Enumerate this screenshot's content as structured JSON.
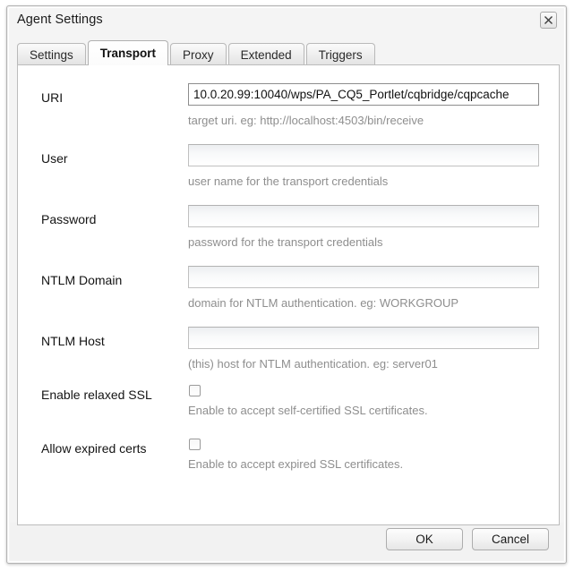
{
  "dialog": {
    "title": "Agent Settings",
    "close_icon": "close-x-icon"
  },
  "tabs": [
    {
      "label": "Settings",
      "active": false
    },
    {
      "label": "Transport",
      "active": true
    },
    {
      "label": "Proxy",
      "active": false
    },
    {
      "label": "Extended",
      "active": false
    },
    {
      "label": "Triggers",
      "active": false
    }
  ],
  "form": {
    "rows": [
      {
        "label": "URI",
        "type": "text",
        "value": "10.0.20.99:10040/wps/PA_CQ5_Portlet/cqbridge/cqpcache",
        "placeholder": "",
        "hint": "target uri. eg: http://localhost:4503/bin/receive"
      },
      {
        "label": "User",
        "type": "text",
        "value": "",
        "placeholder": "",
        "hint": "user name for the transport credentials"
      },
      {
        "label": "Password",
        "type": "password",
        "value": "",
        "placeholder": "",
        "hint": "password for the transport credentials"
      },
      {
        "label": "NTLM Domain",
        "type": "text",
        "value": "",
        "placeholder": "",
        "hint": "domain for NTLM authentication. eg: WORKGROUP"
      },
      {
        "label": "NTLM Host",
        "type": "text",
        "value": "",
        "placeholder": "",
        "hint": "(this) host for NTLM authentication. eg: server01"
      },
      {
        "label": "Enable relaxed SSL",
        "type": "checkbox",
        "checked": false,
        "hint": "Enable to accept self-certified SSL certificates."
      },
      {
        "label": "Allow expired certs",
        "type": "checkbox",
        "checked": false,
        "hint": "Enable to accept expired SSL certificates."
      }
    ]
  },
  "footer": {
    "ok_label": "OK",
    "cancel_label": "Cancel"
  },
  "colors": {
    "dialog_background": "#f2f2f2",
    "panel_background": "#ffffff",
    "text": "#141414",
    "hint_text": "#8e8e8e",
    "border": "#bcbcbc"
  }
}
